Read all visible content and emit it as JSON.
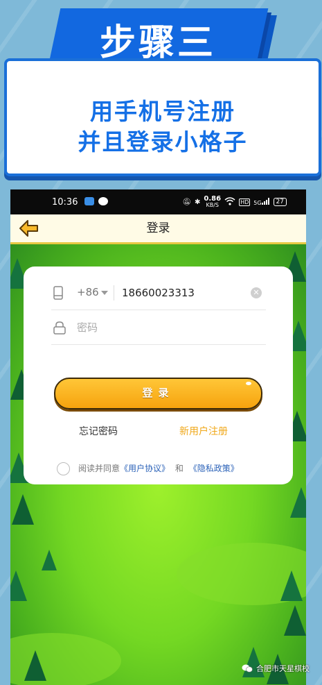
{
  "banner": {
    "step": "步骤三",
    "line1": "用手机号注册",
    "line2": "并且登录小格子"
  },
  "status_bar": {
    "time": "10:36",
    "speed": "0.86",
    "speed_unit": "KB/S",
    "network": "5G",
    "hd": "HD",
    "battery": "27"
  },
  "header": {
    "title": "登录"
  },
  "login_form": {
    "country_code": "+86",
    "phone_value": "18660023313",
    "password_placeholder": "密码",
    "login_button": "登录",
    "forgot_password": "忘记密码",
    "register": "新用户注册",
    "agree_prefix": "阅读并同意",
    "user_agreement": "《用户协议》",
    "and": "和",
    "privacy_policy": "《隐私政策》"
  },
  "watermark": {
    "text": "合肥市天星棋校"
  },
  "colors": {
    "accent_blue": "#1268e0",
    "button_orange": "#f6a30e",
    "register_orange": "#f0a81a",
    "link_blue": "#2b62b8"
  }
}
